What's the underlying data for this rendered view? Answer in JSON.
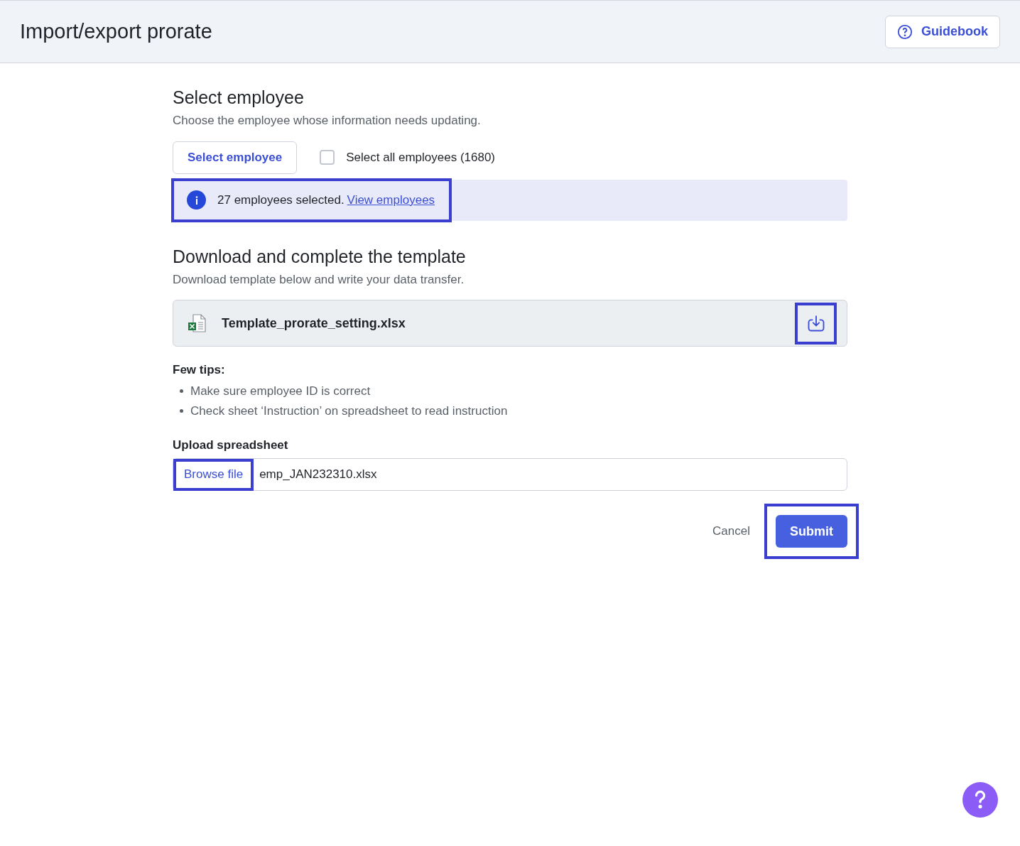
{
  "header": {
    "title": "Import/export prorate",
    "guidebook_button": "Guidebook"
  },
  "select_employee": {
    "title": "Select employee",
    "description": "Choose the employee whose information needs updating.",
    "button": "Select employee",
    "select_all": {
      "label": "Select all employees (1680)",
      "checked": false
    },
    "info": {
      "text": "27 employees selected.",
      "link": "View employees",
      "highlighted": true
    }
  },
  "template": {
    "title": "Download and complete the template",
    "description": "Download template below and write your data transfer.",
    "file_name": "Template_prorate_setting.xlsx",
    "download_highlighted": true
  },
  "tips": {
    "title": "Few tips:",
    "items": [
      "Make sure employee ID is correct",
      "Check sheet ‘Instruction’ on spreadsheet to read instruction"
    ]
  },
  "upload": {
    "label": "Upload spreadsheet",
    "button": "Browse file",
    "button_highlighted": true,
    "value": "emp_JAN232310.xlsx"
  },
  "actions": {
    "cancel": "Cancel",
    "submit": "Submit",
    "submit_highlighted": true
  }
}
